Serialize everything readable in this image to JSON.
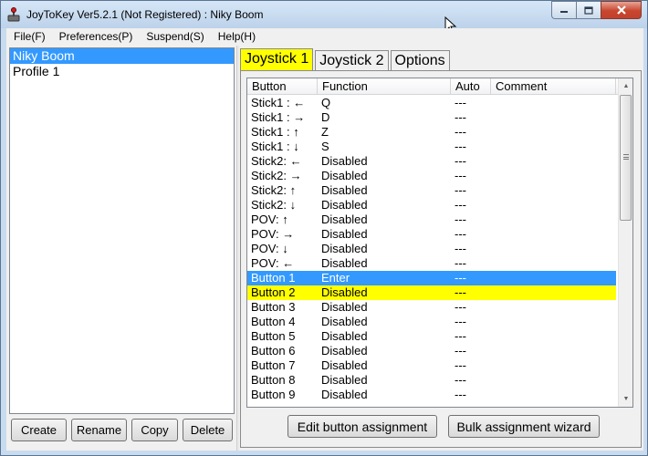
{
  "window": {
    "title": "JoyToKey Ver5.2.1 (Not Registered) : Niky Boom"
  },
  "menu": [
    {
      "label": "File(F)"
    },
    {
      "label": "Preferences(P)"
    },
    {
      "label": "Suspend(S)"
    },
    {
      "label": "Help(H)"
    }
  ],
  "profiles": {
    "items": [
      {
        "label": "Niky Boom",
        "selected": true
      },
      {
        "label": "Profile 1",
        "selected": false
      }
    ],
    "buttons": {
      "create": "Create",
      "rename": "Rename",
      "copy": "Copy",
      "delete": "Delete"
    }
  },
  "tabs": [
    {
      "label": "Joystick 1",
      "active": true
    },
    {
      "label": "Joystick 2",
      "active": false
    },
    {
      "label": "Options",
      "active": false
    }
  ],
  "table": {
    "columns": [
      "Button",
      "Function",
      "Auto",
      "Comment"
    ],
    "rows": [
      {
        "button": "Stick1 : ←",
        "function": "Q",
        "auto": "---",
        "comment": ""
      },
      {
        "button": "Stick1 : →",
        "function": "D",
        "auto": "---",
        "comment": ""
      },
      {
        "button": "Stick1 : ↑",
        "function": "Z",
        "auto": "---",
        "comment": ""
      },
      {
        "button": "Stick1 : ↓",
        "function": "S",
        "auto": "---",
        "comment": ""
      },
      {
        "button": "Stick2: ←",
        "function": "Disabled",
        "auto": "---",
        "comment": ""
      },
      {
        "button": "Stick2: →",
        "function": "Disabled",
        "auto": "---",
        "comment": ""
      },
      {
        "button": "Stick2: ↑",
        "function": "Disabled",
        "auto": "---",
        "comment": ""
      },
      {
        "button": "Stick2: ↓",
        "function": "Disabled",
        "auto": "---",
        "comment": ""
      },
      {
        "button": "POV: ↑",
        "function": "Disabled",
        "auto": "---",
        "comment": ""
      },
      {
        "button": "POV: →",
        "function": "Disabled",
        "auto": "---",
        "comment": ""
      },
      {
        "button": "POV: ↓",
        "function": "Disabled",
        "auto": "---",
        "comment": ""
      },
      {
        "button": "POV: ←",
        "function": "Disabled",
        "auto": "---",
        "comment": ""
      },
      {
        "button": "Button 1",
        "function": "Enter",
        "auto": "---",
        "comment": "",
        "highlight": "blue"
      },
      {
        "button": "Button 2",
        "function": "Disabled",
        "auto": "---",
        "comment": "",
        "highlight": "yellow"
      },
      {
        "button": "Button 3",
        "function": "Disabled",
        "auto": "---",
        "comment": ""
      },
      {
        "button": "Button 4",
        "function": "Disabled",
        "auto": "---",
        "comment": ""
      },
      {
        "button": "Button 5",
        "function": "Disabled",
        "auto": "---",
        "comment": ""
      },
      {
        "button": "Button 6",
        "function": "Disabled",
        "auto": "---",
        "comment": ""
      },
      {
        "button": "Button 7",
        "function": "Disabled",
        "auto": "---",
        "comment": ""
      },
      {
        "button": "Button 8",
        "function": "Disabled",
        "auto": "---",
        "comment": ""
      },
      {
        "button": "Button 9",
        "function": "Disabled",
        "auto": "---",
        "comment": ""
      }
    ]
  },
  "panel_buttons": {
    "edit": "Edit button assignment",
    "bulk": "Bulk assignment wizard"
  },
  "icons": {
    "app": "joystick-icon",
    "minimize": "minimize-icon",
    "maximize": "maximize-icon",
    "close": "close-icon",
    "cursor": "mouse-cursor-icon"
  },
  "colors": {
    "selection_blue": "#3399ff",
    "highlight_yellow": "#ffff00"
  }
}
